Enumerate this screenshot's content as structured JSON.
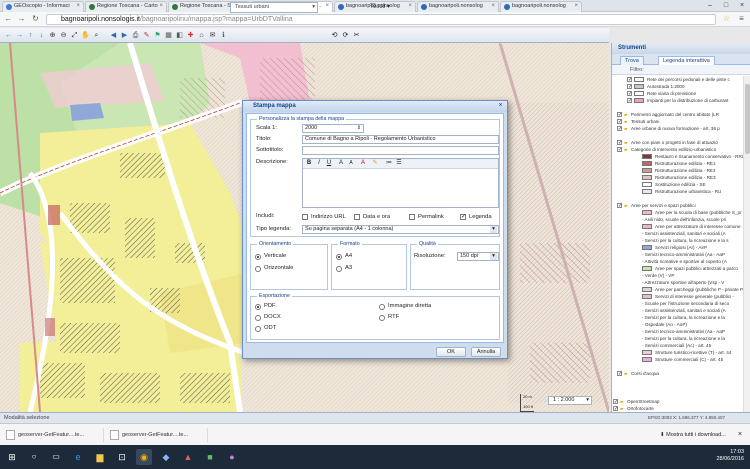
{
  "browser": {
    "tabs": [
      {
        "label": "GEOscopio - Informaci",
        "color": "#3b7bd6"
      },
      {
        "label": "Regione Toscana - Carto",
        "color": "#2f7a3a"
      },
      {
        "label": "Regione Toscana - SITA",
        "color": "#2f7a3a"
      },
      {
        "label": "bagnoaripoli.nonsolog...",
        "color": "#2d6cb5"
      },
      {
        "label": "bagnoaripoli.nonsolog",
        "color": "#2d6cb5"
      },
      {
        "label": "bagnoaripoli.nonsolog",
        "color": "#2d6cb5"
      },
      {
        "label": "bagnoaripoli.nonsolog",
        "color": "#2d6cb5"
      }
    ],
    "url_host": "bagnoaripoli.nonsologis.it",
    "url_path": "/bagnoaripolinu/mappa.jsp?mappa=UrbDTVallina"
  },
  "toolbar": {
    "layer_select": "Tessuti urbani",
    "tools_label": "Tesoli ▾"
  },
  "panel": {
    "title": "Strumenti",
    "tab_search": "Trova",
    "tab_legend": "Legenda interattiva",
    "filter_label": "Filtro:",
    "rows": [
      {
        "text": "Rete dei percorsi pedonali e delle piste c",
        "indent": 22,
        "cb": true,
        "swatch": "#f7f7f7"
      },
      {
        "text": "Autostrada 1:2000",
        "indent": 22,
        "cb": true,
        "swatch": "#c8c8c8"
      },
      {
        "text": "Rete viaria di previsione",
        "indent": 22,
        "cb": true,
        "swatch": "#ffffff"
      },
      {
        "text": "Impianti per la distribuzione di carburant",
        "indent": 22,
        "cb": true,
        "swatch": "#f1a0b8"
      },
      {
        "text": "",
        "indent": 22,
        "cb": false,
        "swatch": ""
      },
      {
        "text": "Perimetro aggiornato del centro abitato (LR",
        "indent": 12,
        "cb": true,
        "swatch": ""
      },
      {
        "text": "Tessuti urbani",
        "indent": 12,
        "cb": true,
        "swatch": ""
      },
      {
        "text": "Aree urbane di nuova formazione - art. 36 p",
        "indent": 12,
        "cb": true,
        "swatch": ""
      },
      {
        "text": "",
        "indent": 12,
        "cb": false,
        "swatch": ""
      },
      {
        "text": "Aree con piani o progetti in fase di attuazio",
        "indent": 12,
        "cb": true,
        "swatch": ""
      },
      {
        "text": "Categorie di intervento edilizio-urbanistico",
        "indent": 12,
        "cb": true,
        "swatch": ""
      },
      {
        "text": "Restauro e risanamento conservativo - RRC",
        "indent": 30,
        "cb": false,
        "swatch": "#7a3b3b"
      },
      {
        "text": "Ristrutturazione edilizia - RE1",
        "indent": 30,
        "cb": false,
        "swatch": "#b36b6b"
      },
      {
        "text": "Ristrutturazione edilizia - RE2",
        "indent": 30,
        "cb": false,
        "swatch": "#cc9a9a"
      },
      {
        "text": "Ristrutturazione edilizia - RE3",
        "indent": 30,
        "cb": false,
        "swatch": "#e3c3c3"
      },
      {
        "text": "Sostituzione edilizia - SE",
        "indent": 30,
        "cb": false,
        "swatch": "#ffffff"
      },
      {
        "text": "Ristrutturazione urbanistica - RU",
        "indent": 30,
        "cb": false,
        "swatch": "#f0e6e6"
      },
      {
        "text": "",
        "indent": 12,
        "cb": false,
        "swatch": ""
      },
      {
        "text": "Aree per servizi e spazi pubblici",
        "indent": 12,
        "cb": true,
        "swatch": ""
      },
      {
        "text": "Aree per la scuola di base (pubbliche S_pr",
        "indent": 30,
        "cb": false,
        "swatch": "#f2b6c8"
      },
      {
        "text": "- Asili nido, scuole dell'infanzia, scuole pri",
        "indent": 30,
        "cb": false,
        "swatch": ""
      },
      {
        "text": "Aree per attrezzature di interesse comune",
        "indent": 30,
        "cb": false,
        "swatch": "#f2b6c8"
      },
      {
        "text": "- Servizi assistenziali, sanitari e sociali (A",
        "indent": 30,
        "cb": false,
        "swatch": ""
      },
      {
        "text": "- Servizi per la cultura, la ricreazione e la s",
        "indent": 30,
        "cb": false,
        "swatch": ""
      },
      {
        "text": "Servizi religiosi (Ar) - AirP",
        "indent": 30,
        "cb": false,
        "swatch": "#8fa8d8"
      },
      {
        "text": "- Servizi tecnico-amministrativi (Aa - AaP",
        "indent": 30,
        "cb": false,
        "swatch": ""
      },
      {
        "text": "- Attività ricreative e sportive al coperto (A",
        "indent": 30,
        "cb": false,
        "swatch": ""
      },
      {
        "text": "Aree per spazi pubblici attrezzati a parco",
        "indent": 30,
        "cb": false,
        "swatch": "#c9e3a0"
      },
      {
        "text": "- Verde (V) - VP",
        "indent": 30,
        "cb": false,
        "swatch": ""
      },
      {
        "text": "- Attrezzature sportive all'aperto (Vsp - V",
        "indent": 30,
        "cb": false,
        "swatch": ""
      },
      {
        "text": "Aree per parcheggi (pubbliche P - private P",
        "indent": 30,
        "cb": false,
        "swatch": "#d9d9d9"
      },
      {
        "text": "Servizi di interesse generale (pubblici -",
        "indent": 30,
        "cb": false,
        "swatch": "#e6c0d0"
      },
      {
        "text": "- Scuole per l'istruzione secondaria di seco",
        "indent": 30,
        "cb": false,
        "swatch": ""
      },
      {
        "text": "- Servizi assistenziali, sanitari e sociali (A",
        "indent": 30,
        "cb": false,
        "swatch": ""
      },
      {
        "text": "- Servizi per la cultura, la ricreazione e la",
        "indent": 30,
        "cb": false,
        "swatch": ""
      },
      {
        "text": "- Ospedale (Ao - AoP)",
        "indent": 30,
        "cb": false,
        "swatch": ""
      },
      {
        "text": "- Servizi tecnico-amministrativi (Aa - AaP",
        "indent": 30,
        "cb": false,
        "swatch": ""
      },
      {
        "text": "- Servizi per la cultura, la ricreazione e la",
        "indent": 30,
        "cb": false,
        "swatch": ""
      },
      {
        "text": "- Servizi commerciali (Ac) - art. 45",
        "indent": 30,
        "cb": false,
        "swatch": ""
      },
      {
        "text": "Strutture turistico-ricettive (T) - art. 44",
        "indent": 30,
        "cb": false,
        "swatch": "#f1c7dc"
      },
      {
        "text": "Strutture commerciali (C) - art. 45",
        "indent": 30,
        "cb": false,
        "swatch": "#e8aee0"
      },
      {
        "text": "",
        "indent": 12,
        "cb": false,
        "swatch": ""
      },
      {
        "text": "Corsi d'acqua",
        "indent": 12,
        "cb": true,
        "swatch": ""
      },
      {
        "text": "",
        "indent": 12,
        "cb": false,
        "swatch": ""
      },
      {
        "text": "",
        "indent": 12,
        "cb": false,
        "swatch": ""
      },
      {
        "text": "",
        "indent": 12,
        "cb": false,
        "swatch": ""
      },
      {
        "text": "OpenStreetmap",
        "indent": 8,
        "cb": true,
        "swatch": ""
      },
      {
        "text": "Ortofotocarte",
        "indent": 8,
        "cb": true,
        "swatch": ""
      }
    ]
  },
  "map": {
    "scale_value": "1 : 2.000",
    "scalebar_top": "20 m",
    "scalebar_bottom": "100 ft"
  },
  "status": {
    "mode": "Modalità selezione",
    "coords": "EPSG:3003   X: 1.696.377   Y: 4.850.407"
  },
  "dialog": {
    "title": "Stampa mappa",
    "section_personalize": "Personalizza la stampa della mappa",
    "scale_label": "Scala 1:",
    "scale_value": "2000",
    "title_label": "Titolo:",
    "title_value": "Comune di Bagno a Ripoli - Regolamento Urbanistico",
    "subtitle_label": "Sottotitolo:",
    "subtitle_value": "",
    "description_label": "Descrizione:",
    "include_label": "Includi:",
    "include_options": [
      {
        "label": "Indirizzo URL",
        "checked": false
      },
      {
        "label": "Data e ora",
        "checked": false
      },
      {
        "label": "Permalink",
        "checked": false
      },
      {
        "label": "Legenda",
        "checked": true
      }
    ],
    "legend_type_label": "Tipo legenda:",
    "legend_type_value": "Su pagina separata (A4 - 1 colonna)",
    "orientation_title": "Orientamento",
    "orientation_options": [
      {
        "label": "Verticale",
        "checked": true
      },
      {
        "label": "Orizzontale",
        "checked": false
      }
    ],
    "format_title": "Formato",
    "format_options": [
      {
        "label": "A4",
        "checked": true
      },
      {
        "label": "A3",
        "checked": false
      }
    ],
    "quality_title": "Qualità",
    "resolution_label": "Risoluzione:",
    "resolution_value": "150 dpi",
    "export_title": "Esportazione",
    "export_options": [
      {
        "label": "PDF",
        "checked": true
      },
      {
        "label": "DOCX",
        "checked": false
      },
      {
        "label": "ODT",
        "checked": false
      },
      {
        "label": "Immagine diretta",
        "checked": false
      },
      {
        "label": "RTF",
        "checked": false
      }
    ],
    "ok_label": "OK",
    "cancel_label": "Annulla"
  },
  "downloads": {
    "items": [
      "geoserver-GetFeatur....te...",
      "geoserver-GetFeatur....te..."
    ],
    "show_all": "Mostra tutti i download..."
  },
  "taskbar": {
    "time": "17:03",
    "date": "28/06/2016"
  }
}
